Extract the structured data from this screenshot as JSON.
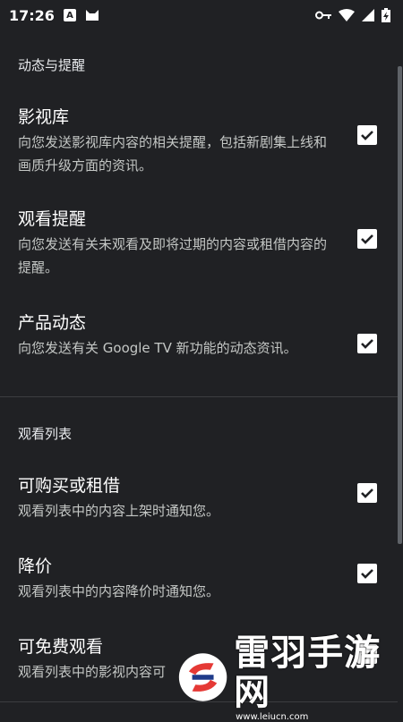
{
  "status_bar": {
    "time": "17:26",
    "notification_icons": [
      "A",
      "cat-icon"
    ],
    "right_icons": [
      "key-icon",
      "wifi-icon",
      "signal-icon",
      "battery-charging-icon"
    ]
  },
  "sections": [
    {
      "title": "动态与提醒",
      "items": [
        {
          "title": "影视库",
          "description": "向您发送影视库内容的相关提醒，包括新剧集上线和画质升级方面的资讯。",
          "checked": true
        },
        {
          "title": "观看提醒",
          "description": "向您发送有关未观看及即将过期的内容或租借内容的提醒。",
          "checked": true
        },
        {
          "title": "产品动态",
          "description": "向您发送有关 Google TV 新功能的动态资讯。",
          "checked": true
        }
      ]
    },
    {
      "title": "观看列表",
      "items": [
        {
          "title": "可购买或租借",
          "description": "观看列表中的内容上架时通知您。",
          "checked": true
        },
        {
          "title": "降价",
          "description": "观看列表中的内容降价时通知您。",
          "checked": true
        },
        {
          "title": "可免费观看",
          "description": "观看列表中的影视内容可",
          "checked": true
        }
      ]
    }
  ],
  "watermark": {
    "brand": "雷羽手游网",
    "url": "www.leiucn.com"
  },
  "colors": {
    "background": "#202124",
    "text_primary": "#ffffff",
    "text_secondary": "#c4c7c5",
    "checkbox": "#ffffff",
    "check_mark": "#202124"
  }
}
